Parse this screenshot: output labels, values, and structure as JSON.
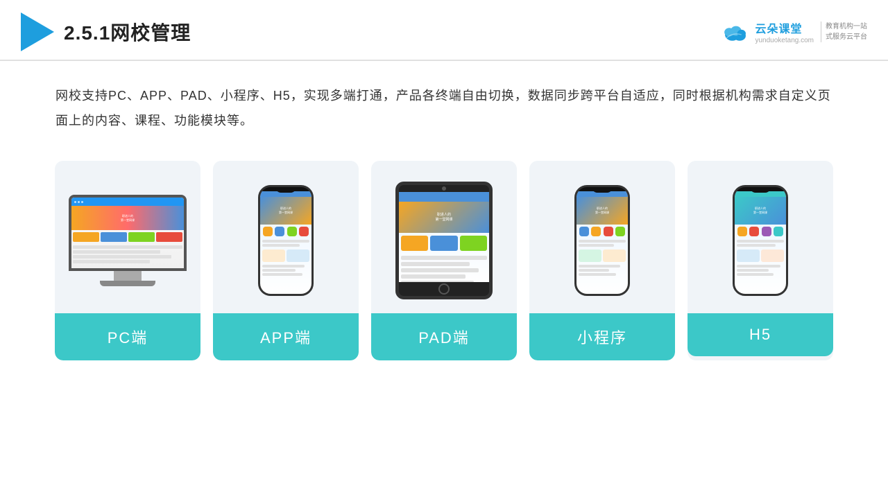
{
  "header": {
    "title": "2.5.1网校管理",
    "brand": {
      "name_cn": "云朵课堂",
      "tagline": "教育机构一站\n式服务云平台",
      "url": "yunduoketang.com"
    }
  },
  "description": {
    "text": "网校支持PC、APP、PAD、小程序、H5，实现多端打通，产品各终端自由切换，数据同步跨平台自适应，同时根据机构需求自定义页面上的内容、课程、功能模块等。"
  },
  "cards": [
    {
      "id": "pc",
      "label": "PC端",
      "type": "pc"
    },
    {
      "id": "app",
      "label": "APP端",
      "type": "phone"
    },
    {
      "id": "pad",
      "label": "PAD端",
      "type": "tablet"
    },
    {
      "id": "miniprogram",
      "label": "小程序",
      "type": "phone"
    },
    {
      "id": "h5",
      "label": "H5",
      "type": "phone"
    }
  ],
  "accent_color": "#3cc8c8"
}
